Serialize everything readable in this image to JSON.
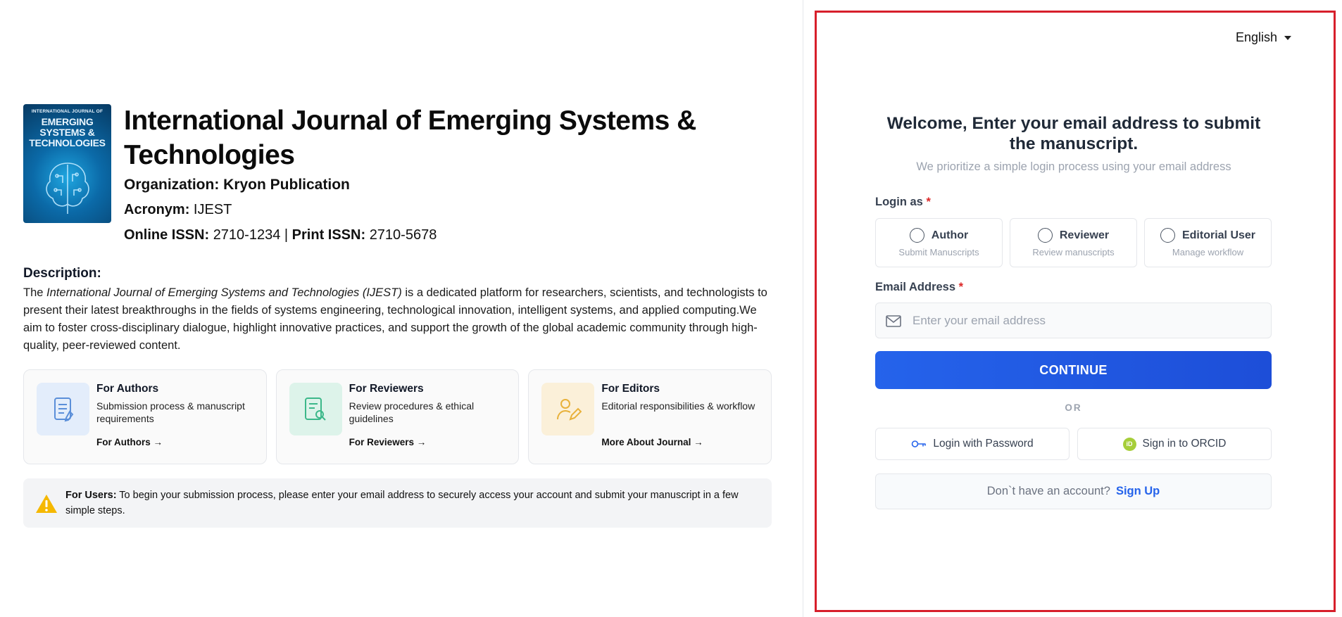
{
  "journal": {
    "cover": {
      "small_text": "INTERNATIONAL JOURNAL OF",
      "big_text": "EMERGING SYSTEMS & TECHNOLOGIES"
    },
    "title": "International Journal of Emerging Systems & Technologies",
    "organization": "Organization: Kryon Publication",
    "acronym_label": "Acronym:",
    "acronym_value": "IJEST",
    "online_issn_label": "Online ISSN:",
    "online_issn_value": "2710-1234",
    "separator": "|",
    "print_issn_label": "Print ISSN:",
    "print_issn_value": "2710-5678"
  },
  "description": {
    "heading": "Description:",
    "prefix": "The ",
    "italic_name": "International Journal of Emerging Systems and Technologies (IJEST)",
    "body": " is a dedicated platform for researchers, scientists, and technologists to present their latest breakthroughs in the fields of systems engineering, technological innovation, intelligent systems, and applied computing.We aim to foster cross-disciplinary dialogue, highlight innovative practices, and support the growth of the global academic community through high-quality, peer-reviewed content."
  },
  "cards": [
    {
      "title": "For Authors",
      "description": "Submission process & manuscript requirements",
      "link": "For Authors →",
      "icon": "document-icon",
      "bg": "#e3edfb",
      "fg": "#5b8fd9"
    },
    {
      "title": "For Reviewers",
      "description": "Review procedures & ethical guidelines",
      "link": "For Reviewers →",
      "icon": "document-search-icon",
      "bg": "#ddf3ea",
      "fg": "#3cb88a"
    },
    {
      "title": "For Editors",
      "description": "Editorial responsibilities & workflow",
      "link": "More About Journal →",
      "icon": "user-edit-icon",
      "bg": "#fbf0d9",
      "fg": "#e8b13a"
    }
  ],
  "notice": {
    "label": "For Users:",
    "text": " To begin your submission process, please enter your email address to securely access your account and submit your manuscript in a few simple steps.",
    "icon": "warning-icon"
  },
  "login": {
    "language": "English",
    "welcome": "Welcome, Enter your email address to submit the manuscript.",
    "subtitle": "We prioritize a simple login process using your email address",
    "login_as_label": "Login as",
    "required_mark": "*",
    "roles": [
      {
        "title": "Author",
        "subtitle": "Submit Manuscripts"
      },
      {
        "title": "Reviewer",
        "subtitle": "Review manuscripts"
      },
      {
        "title": "Editorial User",
        "subtitle": "Manage workflow"
      }
    ],
    "email_label": "Email Address",
    "email_placeholder": "Enter your email address",
    "email_value": "",
    "continue_label": "CONTINUE",
    "or_label": "OR",
    "password_label": "Login with Password",
    "orcid_label": "Sign in to ORCID",
    "orcid_badge": "iD",
    "no_account": "Don`t have an account?",
    "signup_label": "Sign Up"
  },
  "colors": {
    "accent": "#2563eb",
    "highlight_border": "#d71f2b",
    "required": "#dc2626",
    "warning": "#f5b800"
  }
}
